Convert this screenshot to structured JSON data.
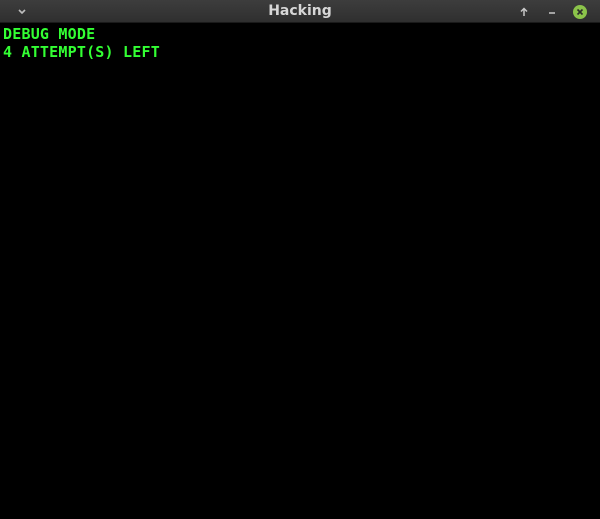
{
  "window": {
    "title": "Hacking"
  },
  "titlebar": {
    "menu_icon": "chevron-down-icon",
    "maximize_icon": "arrow-up-icon",
    "minimize_icon": "minus-icon",
    "close_icon": "close-icon",
    "close_color": "#8bc34a"
  },
  "terminal": {
    "text_color": "#33ff33",
    "background": "#000000",
    "lines": [
      "DEBUG MODE",
      "4 ATTEMPT(S) LEFT"
    ]
  }
}
